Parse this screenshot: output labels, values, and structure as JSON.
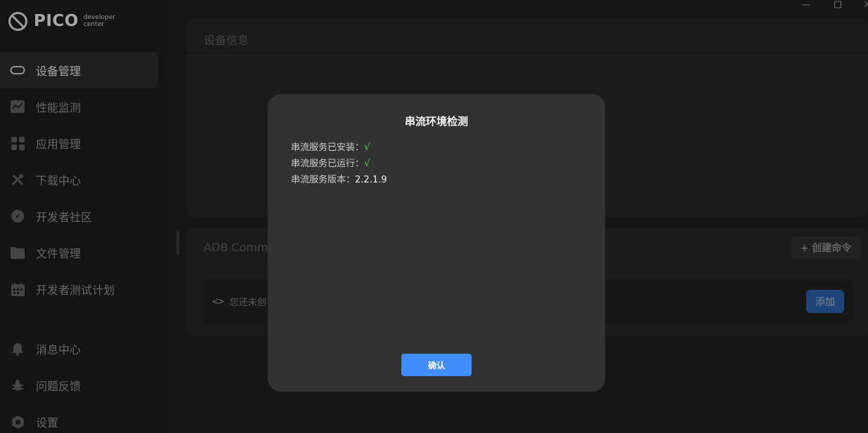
{
  "logo": {
    "word": "PICO",
    "sub_line1": "developer",
    "sub_line2": "center"
  },
  "sidebar": {
    "items": [
      {
        "label": "设备管理",
        "icon": "vr-headset-icon",
        "active": true
      },
      {
        "label": "性能监测",
        "icon": "chart-icon"
      },
      {
        "label": "应用管理",
        "icon": "apps-grid-icon"
      },
      {
        "label": "下载中心",
        "icon": "tools-icon"
      },
      {
        "label": "开发者社区",
        "icon": "compass-icon"
      },
      {
        "label": "文件管理",
        "icon": "folder-icon"
      },
      {
        "label": "开发者测试计划",
        "icon": "calendar-icon"
      }
    ],
    "bottom_items": [
      {
        "label": "消息中心",
        "icon": "bell-icon"
      },
      {
        "label": "问题反馈",
        "icon": "bug-icon"
      },
      {
        "label": "设置",
        "icon": "gear-icon"
      }
    ]
  },
  "device_panel": {
    "title": "设备信息"
  },
  "adb_panel": {
    "title": "ADB Comma",
    "create_label": "+ 创建命令",
    "empty_text": "您还未创",
    "add_label": "添加"
  },
  "modal": {
    "title": "串流环境检测",
    "installed_label": "串流服务已安装：",
    "installed_mark": "√",
    "running_label": "串流服务已运行：",
    "running_mark": "√",
    "version_label": "串流服务版本：",
    "version_value": "2.2.1.9",
    "confirm_label": "确认"
  }
}
